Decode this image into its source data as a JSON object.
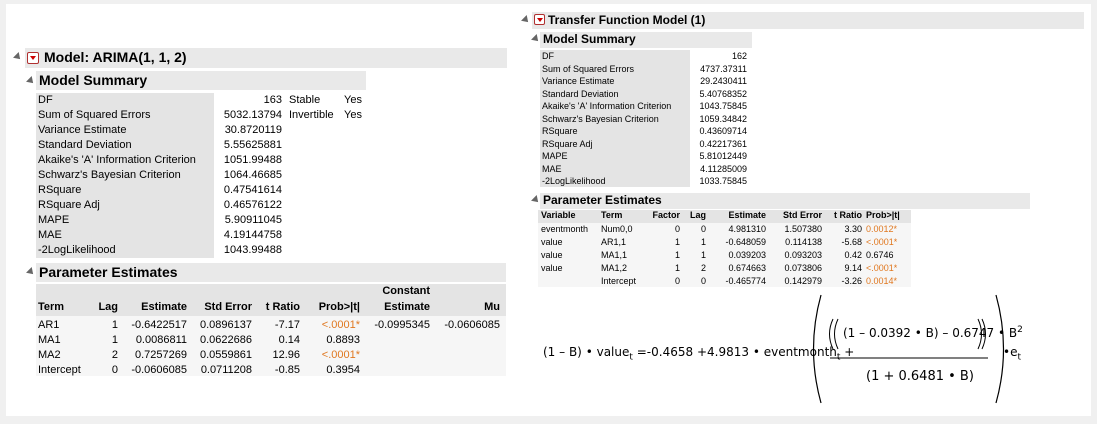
{
  "left": {
    "title": "Model: ARIMA(1, 1, 2)",
    "model_summary": {
      "title": "Model Summary",
      "rows": [
        {
          "label": "DF",
          "value": "163"
        },
        {
          "label": "Sum of Squared Errors",
          "value": "5032.13794"
        },
        {
          "label": "Variance Estimate",
          "value": "30.8720119"
        },
        {
          "label": "Standard Deviation",
          "value": "5.55625881"
        },
        {
          "label": "Akaike's 'A' Information Criterion",
          "value": "1051.99488"
        },
        {
          "label": "Schwarz's Bayesian Criterion",
          "value": "1064.46685"
        },
        {
          "label": "RSquare",
          "value": "0.47541614"
        },
        {
          "label": "RSquare Adj",
          "value": "0.46576122"
        },
        {
          "label": "MAPE",
          "value": "5.90911045"
        },
        {
          "label": "MAE",
          "value": "4.19144758"
        },
        {
          "label": "-2LogLikelihood",
          "value": "1043.99488"
        }
      ],
      "flags": [
        {
          "label": "Stable",
          "value": "Yes"
        },
        {
          "label": "Invertible",
          "value": "Yes"
        }
      ]
    },
    "param": {
      "title": "Parameter Estimates",
      "headers": {
        "term": "Term",
        "lag": "Lag",
        "estimate": "Estimate",
        "std": "Std Error",
        "t": "t Ratio",
        "prob": "Prob>|t|",
        "const_top": "Constant",
        "const_bottom": "Estimate",
        "mu": "Mu"
      },
      "rows": [
        {
          "term": "AR1",
          "lag": "1",
          "estimate": "-0.6422517",
          "std": "0.0896137",
          "t": "-7.17",
          "prob": "<.0001*"
        },
        {
          "term": "MA1",
          "lag": "1",
          "estimate": "0.0086811",
          "std": "0.0622686",
          "t": "0.14",
          "prob": "0.8893"
        },
        {
          "term": "MA2",
          "lag": "2",
          "estimate": "0.7257269",
          "std": "0.0559861",
          "t": "12.96",
          "prob": "<.0001*"
        },
        {
          "term": "Intercept",
          "lag": "0",
          "estimate": "-0.0606085",
          "std": "0.0711208",
          "t": "-0.85",
          "prob": "0.3954"
        }
      ],
      "constant_estimate": "-0.0995345",
      "mu": "-0.0606085"
    }
  },
  "right": {
    "title": "Transfer Function Model (1)",
    "model_summary": {
      "title": "Model Summary",
      "rows": [
        {
          "label": "DF",
          "value": "162"
        },
        {
          "label": "Sum of Squared Errors",
          "value": "4737.37311"
        },
        {
          "label": "Variance Estimate",
          "value": "29.2430411"
        },
        {
          "label": "Standard Deviation",
          "value": "5.40768352"
        },
        {
          "label": "Akaike's 'A' Information Criterion",
          "value": "1043.75845"
        },
        {
          "label": "Schwarz's Bayesian Criterion",
          "value": "1059.34842"
        },
        {
          "label": "RSquare",
          "value": "0.43609714"
        },
        {
          "label": "RSquare Adj",
          "value": "0.42217361"
        },
        {
          "label": "MAPE",
          "value": "5.81012449"
        },
        {
          "label": "MAE",
          "value": "4.11285009"
        },
        {
          "label": "-2LogLikelihood",
          "value": "1033.75845"
        }
      ]
    },
    "param": {
      "title": "Parameter Estimates",
      "headers": {
        "variable": "Variable",
        "term": "Term",
        "factor": "Factor",
        "lag": "Lag",
        "estimate": "Estimate",
        "std": "Std Error",
        "t": "t Ratio",
        "prob": "Prob>|t|"
      },
      "rows": [
        {
          "variable": "eventmonth",
          "term": "Num0,0",
          "factor": "0",
          "lag": "0",
          "estimate": "4.981310",
          "std": "1.507380",
          "t": "3.30",
          "prob": "0.0012*"
        },
        {
          "variable": "value",
          "term": "AR1,1",
          "factor": "1",
          "lag": "1",
          "estimate": "-0.648059",
          "std": "0.114138",
          "t": "-5.68",
          "prob": "<.0001*"
        },
        {
          "variable": "value",
          "term": "MA1,1",
          "factor": "1",
          "lag": "1",
          "estimate": "0.039203",
          "std": "0.093203",
          "t": "0.42",
          "prob": "0.6746"
        },
        {
          "variable": "value",
          "term": "MA1,2",
          "factor": "1",
          "lag": "2",
          "estimate": "0.674663",
          "std": "0.073806",
          "t": "9.14",
          "prob": "<.0001*"
        },
        {
          "variable": "",
          "term": "Intercept",
          "factor": "0",
          "lag": "0",
          "estimate": "-0.465774",
          "std": "0.142979",
          "t": "-3.26",
          "prob": "0.0014*"
        }
      ]
    },
    "equation": {
      "lhs_open": "(1 – B)",
      "dot": "•",
      "value_word": "value",
      "sub_t": "t",
      "equals": "=",
      "const": "-0.4658",
      "plus": "+",
      "coef": "4.9813",
      "event_word": "eventmonth",
      "num_inner": "(1 – 0.0392 • B)",
      "num_mid": "– 0.6747 • B",
      "num_exp": "2",
      "den": "(1 + 0.6481 • B)",
      "e_word": "e"
    }
  },
  "colors": {
    "significant": "#e07820",
    "header_bg": "#e9e9e9",
    "label_bg": "#e4e4e4",
    "red_button": "#c00000"
  }
}
